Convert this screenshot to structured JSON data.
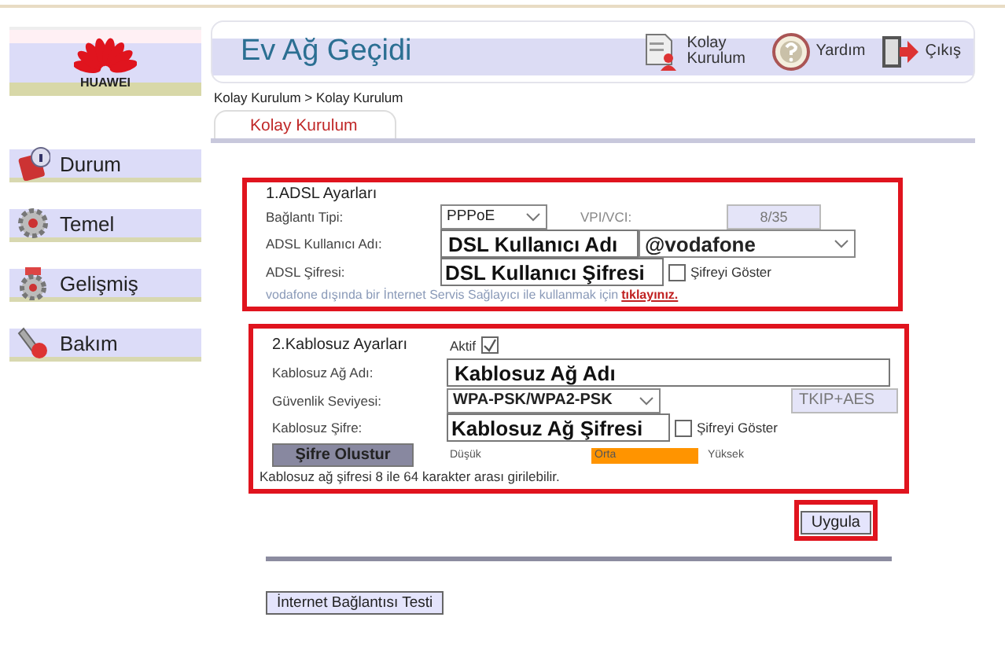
{
  "sidebar": {
    "logo_text": "HUAWEI",
    "items": [
      {
        "label": "Durum"
      },
      {
        "label": "Temel"
      },
      {
        "label": "Gelişmiş"
      },
      {
        "label": "Bakım"
      }
    ]
  },
  "header": {
    "title": "Ev Ağ Geçidi",
    "actions": [
      {
        "label": "Kolay Kurulum"
      },
      {
        "label": "Yardım"
      },
      {
        "label": "Çıkış"
      }
    ]
  },
  "breadcrumb": "Kolay Kurulum > Kolay Kurulum",
  "tabs": [
    {
      "label": "Kolay Kurulum",
      "selected": true
    }
  ],
  "adsl": {
    "heading": "1.ADSL Ayarları",
    "connection_type": {
      "label": "Bağlantı Tipi:",
      "value": "PPPoE"
    },
    "vpi_vci": {
      "label": "VPI/VCI:",
      "value": "8/35",
      "disabled": true
    },
    "username": {
      "label": "ADSL Kullanıcı Adı:",
      "value": "DSL Kullanıcı Adı",
      "domain": "@vodafone"
    },
    "password": {
      "label": "ADSL Şifresi:",
      "value": "DSL Kullanıcı Şifresi",
      "show_label": "Şifreyi Göster",
      "show_checked": false
    },
    "note": "vodafone dışında bir İnternet Servis Sağlayıcı ile kullanmak için",
    "link": "tıklayınız."
  },
  "wireless": {
    "heading": "2.Kablosuz Ayarları",
    "enabled": {
      "label": "Aktif",
      "checked": true
    },
    "ssid": {
      "label": "Kablosuz Ağ Adı:",
      "value": "Kablosuz Ağ Adı"
    },
    "security": {
      "label": "Güvenlik Seviyesi:",
      "value": "WPA-PSK/WPA2-PSK",
      "encryption": "TKIP+AES"
    },
    "password": {
      "label": "Kablosuz Şifre:",
      "value": "Kablosuz Ağ Şifresi",
      "show_label": "Şifreyi Göster",
      "show_checked": false
    },
    "generate_button": "Şifre Olustur",
    "strength": [
      {
        "label": "Düşük",
        "selected": false
      },
      {
        "label": "Orta",
        "selected": true
      },
      {
        "label": "Yüksek",
        "selected": false
      }
    ],
    "note": "Kablosuz ağ şifresi 8 ile 64 karakter arası girilebilir."
  },
  "apply_button": "Uygula",
  "test_button": "İnternet Bağlantısı Testi"
}
